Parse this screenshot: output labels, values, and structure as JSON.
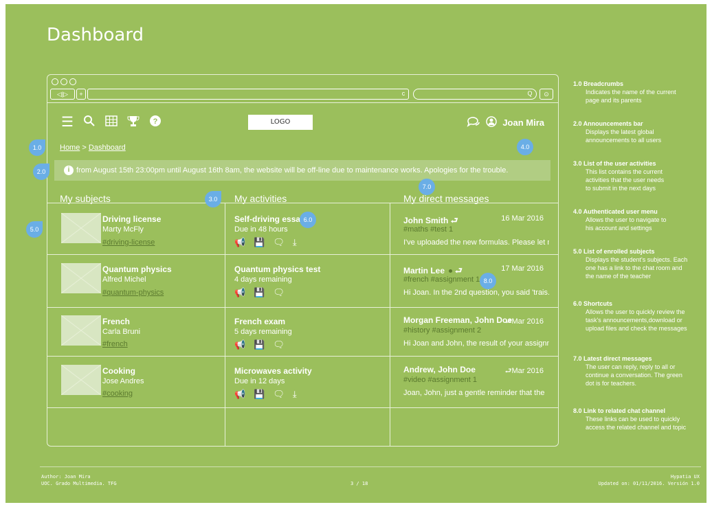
{
  "page": {
    "title": "Dashboard"
  },
  "browser": {
    "back": "◁",
    "forward": "▷",
    "new_tab": "+",
    "reload": "c",
    "search": "Q",
    "download": "⊙"
  },
  "toolbar": {
    "icons": [
      "menu-icon",
      "search-icon",
      "grid-icon",
      "trophy-icon",
      "help-icon"
    ],
    "logo": "LOGO",
    "user_name": "Joan Mira"
  },
  "breadcrumb": {
    "home": "Home",
    "separator": ">",
    "current": "Dashboard"
  },
  "announcement": {
    "text": "from August 15th 23:00pm until August 16th 8am, the website will be off-line due to maintenance works. Apologies for the trouble."
  },
  "columns": {
    "subjects": "My subjects",
    "activities": "My activities",
    "messages": "My direct messages"
  },
  "subjects": [
    {
      "title": "Driving license",
      "teacher": "Marty McFly",
      "tag": "#driving-license"
    },
    {
      "title": "Quantum physics",
      "teacher": "Alfred Michel",
      "tag": "#quantum-physics"
    },
    {
      "title": "French",
      "teacher": "Carla Bruni",
      "tag": "#french"
    },
    {
      "title": "Cooking",
      "teacher": "Jose Andres",
      "tag": "#cooking"
    }
  ],
  "activities": [
    {
      "title": "Self-driving essay",
      "due": "Due in 48 hours"
    },
    {
      "title": "Quantum physics test",
      "due": "4 days remaining"
    },
    {
      "title": "French exam",
      "due": "5 days remaining"
    },
    {
      "title": "Microwaves activity",
      "due": "Due in 12 days"
    }
  ],
  "messages": [
    {
      "from": "John Smith",
      "date": "16 Mar 2016",
      "tags": "#maths  #test 1",
      "text": "I've uploaded the new formulas. Please let me ..."
    },
    {
      "from": "Martin Lee",
      "date": "17 Mar 2016",
      "tags": "#french  #assignment 1",
      "text": "Hi Joan. In the 2nd question, you said 'trais..."
    },
    {
      "from": "Morgan Freeman, John Doe",
      "date": "Mar 2016",
      "tags": "#history  #assignment 2",
      "text": "Hi Joan and John, the result of your assignment"
    },
    {
      "from": "Andrew, John Doe",
      "date": "Mar 2016",
      "tags": "#video  #assignment 1",
      "text": "Joan, John,  just a gentle reminder that the"
    }
  ],
  "markers": [
    "1.0",
    "2.0",
    "3.0",
    "4.0",
    "5.0",
    "6.0",
    "7.0",
    "8.0"
  ],
  "notes": [
    {
      "head": "1.0  Breadcrumbs",
      "body": [
        "Indicates the name of the current",
        "page and its parents"
      ]
    },
    {
      "head": "2.0  Announcements bar",
      "body": [
        "Displays the latest global",
        "announcements to all users"
      ]
    },
    {
      "head": "3.0  List of the user activities",
      "body": [
        "This list contains the current",
        "activities that the user needs",
        "to submit in the next days"
      ]
    },
    {
      "head": "4.0  Authenticated user menu",
      "body": [
        "Allows the user to navigate to",
        "his account and settings"
      ]
    },
    {
      "head": "5.0  List of enrolled subjects",
      "body": [
        "Displays the student's subjects. Each",
        "one has a link to the chat room and",
        "the name of the teacher"
      ]
    },
    {
      "head": "6.0  Shortcuts",
      "body": [
        "Allows the user to quickly review the",
        "task's announcements,download or",
        "upload files and check the messages"
      ]
    },
    {
      "head": "7.0  Latest direct messages",
      "body": [
        "The user can reply, reply to all or",
        "continue a conversation. The green",
        "dot is for teachers."
      ]
    },
    {
      "head": "8.0  Link to related chat channel",
      "body": [
        "These links can be used to quickly",
        "access the related channel and topic"
      ]
    }
  ],
  "footer": {
    "author": "Author: Joan Mira",
    "org": "UOC. Grado Multimedia. TFG",
    "page": "3 / 18",
    "brand": "Hypatia UX",
    "updated": "Updated on: 01/11/2016. Versión 1.0"
  },
  "colors": {
    "background": "#9bbf5c",
    "marker": "#6aaee6",
    "tag": "#5b7a2f"
  }
}
